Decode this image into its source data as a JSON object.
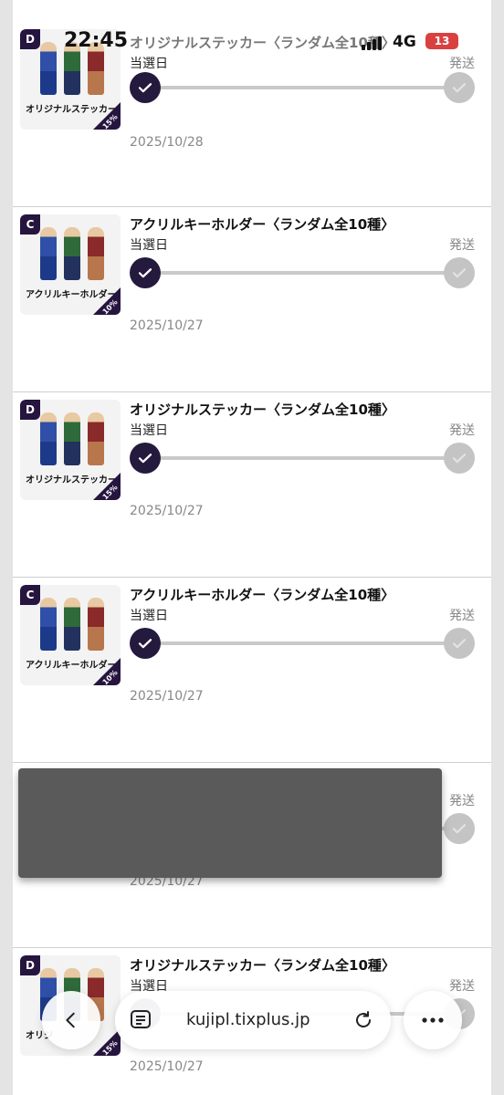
{
  "status_bar": {
    "time": "22:45",
    "network": "4G",
    "battery": "13"
  },
  "colors": {
    "accent": "#231a3e",
    "inactive": "#c4c4c4",
    "battery": "#d94141"
  },
  "items": [
    {
      "title": "オリジナルステッカー〈ランダム全10種〉",
      "label_left": "当選日",
      "label_right": "発送",
      "date": "2025/10/28",
      "thumb": {
        "grade": "D",
        "caption": "オリジナルステッカー",
        "percent": "15%"
      }
    },
    {
      "title": "アクリルキーホルダー〈ランダム全10種〉",
      "label_left": "当選日",
      "label_right": "発送",
      "date": "2025/10/27",
      "thumb": {
        "grade": "C",
        "caption": "アクリルキーホルダー",
        "percent": "10%"
      }
    },
    {
      "title": "オリジナルステッカー〈ランダム全10種〉",
      "label_left": "当選日",
      "label_right": "発送",
      "date": "2025/10/27",
      "thumb": {
        "grade": "D",
        "caption": "オリジナルステッカー",
        "percent": "15%"
      }
    },
    {
      "title": "アクリルキーホルダー〈ランダム全10種〉",
      "label_left": "当選日",
      "label_right": "発送",
      "date": "2025/10/27",
      "thumb": {
        "grade": "C",
        "caption": "アクリルキーホルダー",
        "percent": "10%"
      }
    },
    {
      "title": "",
      "label_left": "",
      "label_right": "発送",
      "date": "2025/10/27",
      "thumb": {
        "grade": "",
        "caption": "",
        "percent": ""
      }
    },
    {
      "title": "オリジナルステッカー〈ランダム全10種〉",
      "label_left": "当選日",
      "label_right": "発送",
      "date": "2025/10/27",
      "thumb": {
        "grade": "D",
        "caption": "オリジ",
        "percent": "15%"
      }
    }
  ],
  "toolbar": {
    "url": "kujipl.tixplus.jp",
    "back_icon": "chevron-left-icon",
    "reader_icon": "reader-icon",
    "reload_icon": "reload-icon",
    "more_icon": "more-icon"
  }
}
